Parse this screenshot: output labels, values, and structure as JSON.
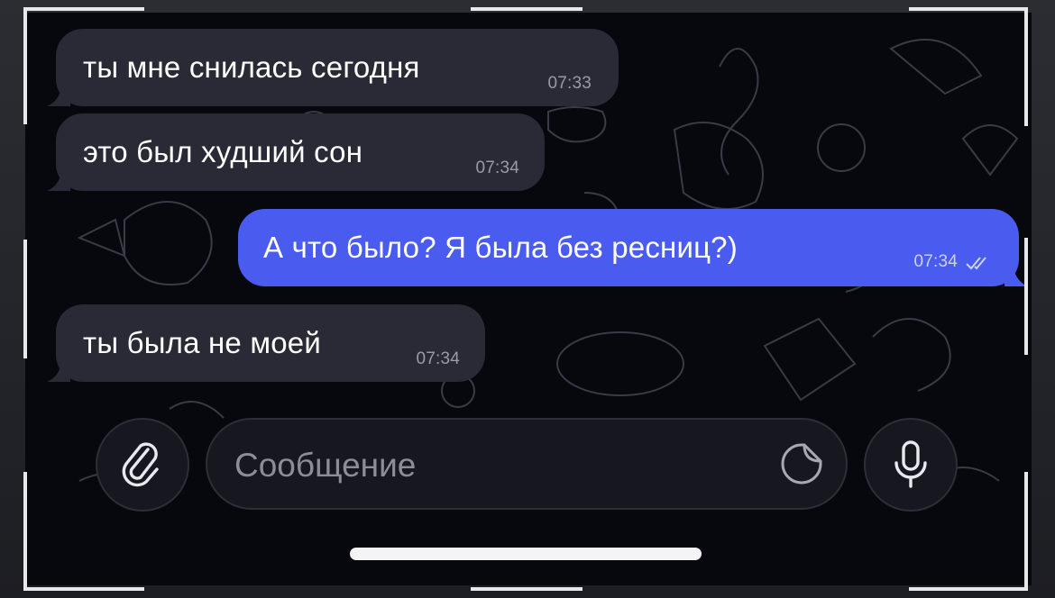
{
  "messages": [
    {
      "direction": "incoming",
      "text": "ты мне снилась сегодня",
      "time": "07:33"
    },
    {
      "direction": "incoming",
      "text": "это был худший сон",
      "time": "07:34"
    },
    {
      "direction": "outgoing",
      "text": "А что было? Я была без ресниц?)",
      "time": "07:34",
      "status": "read",
      "status_icon": "double-check-icon"
    },
    {
      "direction": "incoming",
      "text": "ты была не моей",
      "time": "07:34"
    }
  ],
  "composer": {
    "placeholder": "Сообщение",
    "attach_icon": "paperclip-icon",
    "sticker_icon": "sticker-icon",
    "voice_icon": "microphone-icon"
  },
  "colors": {
    "background": "#07070e",
    "incoming_bubble": "#2a2a36",
    "outgoing_bubble": "#4a5cf0",
    "text": "#ffffff"
  }
}
